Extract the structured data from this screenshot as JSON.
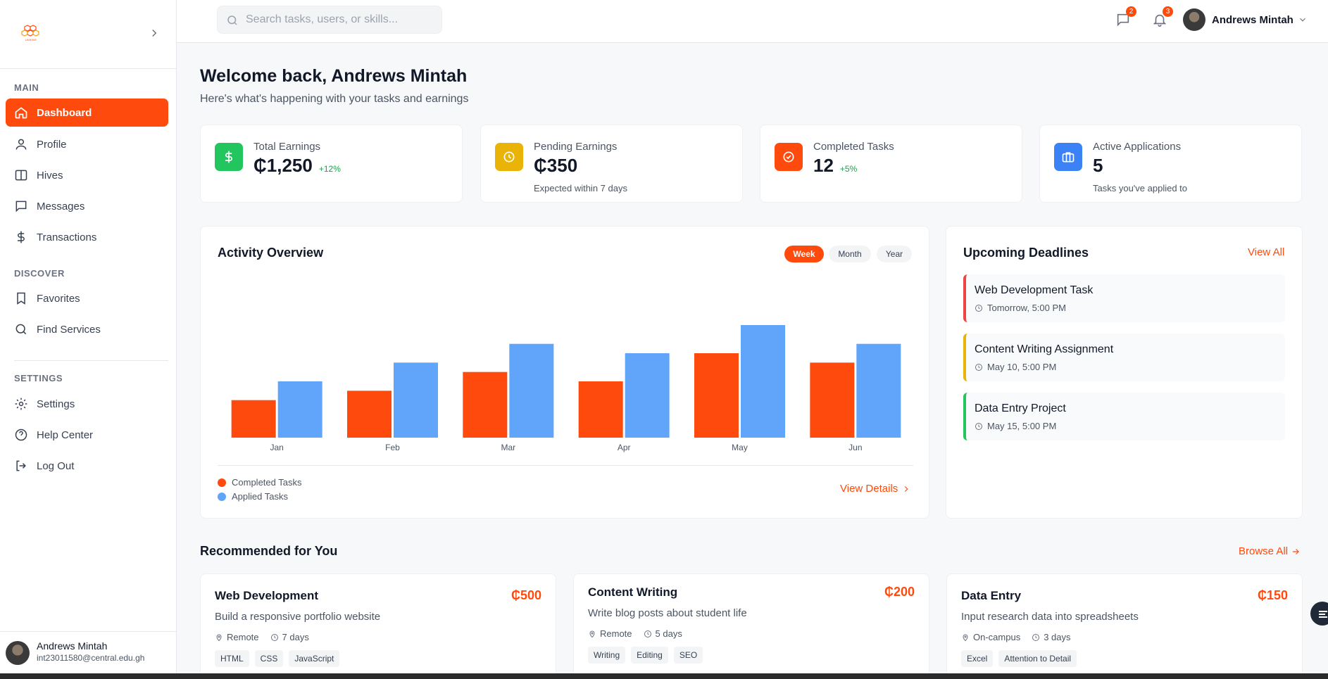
{
  "sidebar": {
    "logo_label": "UNIHIVE",
    "sections": {
      "main": "MAIN",
      "discover": "DISCOVER",
      "settings": "SETTINGS"
    },
    "items": {
      "dashboard": "Dashboard",
      "profile": "Profile",
      "hives": "Hives",
      "messages": "Messages",
      "transactions": "Transactions",
      "favorites": "Favorites",
      "find_services": "Find Services",
      "settings": "Settings",
      "help_center": "Help Center",
      "log_out": "Log Out"
    },
    "user": {
      "name": "Andrews Mintah",
      "email": "int23011580@central.edu.gh"
    }
  },
  "topbar": {
    "search_placeholder": "Search tasks, users, or skills...",
    "messages_badge": "2",
    "notifications_badge": "3",
    "user_name": "Andrews Mintah"
  },
  "welcome": {
    "title": "Welcome back, Andrews Mintah",
    "subtitle": "Here's what's happening with your tasks and earnings"
  },
  "stats": [
    {
      "label": "Total Earnings",
      "value": "₵1,250",
      "delta": "+12%",
      "note": ""
    },
    {
      "label": "Pending Earnings",
      "value": "₵350",
      "delta": "",
      "note": "Expected within 7 days"
    },
    {
      "label": "Completed Tasks",
      "value": "12",
      "delta": "+5%",
      "note": ""
    },
    {
      "label": "Active Applications",
      "value": "5",
      "delta": "",
      "note": "Tasks you've applied to"
    }
  ],
  "activity": {
    "title": "Activity Overview",
    "ranges": [
      "Week",
      "Month",
      "Year"
    ],
    "active_range": "Week",
    "view_details": "View Details",
    "colors": {
      "completed": "#ff4a0d",
      "applied": "#60a5fa"
    }
  },
  "chart_data": {
    "type": "bar",
    "categories": [
      "Jan",
      "Feb",
      "Mar",
      "Apr",
      "May",
      "Jun"
    ],
    "series": [
      {
        "name": "Completed Tasks",
        "values": [
          4,
          5,
          7,
          6,
          9,
          8
        ]
      },
      {
        "name": "Applied Tasks",
        "values": [
          6,
          8,
          10,
          9,
          12,
          10
        ]
      }
    ],
    "ylim": [
      0,
      12
    ]
  },
  "deadlines": {
    "title": "Upcoming Deadlines",
    "view_all": "View All",
    "items": [
      {
        "title": "Web Development Task",
        "due": "Tomorrow, 5:00 PM",
        "color": "#ef4444"
      },
      {
        "title": "Content Writing Assignment",
        "due": "May 10, 5:00 PM",
        "color": "#eab308"
      },
      {
        "title": "Data Entry Project",
        "due": "May 15, 5:00 PM",
        "color": "#22c55e"
      }
    ]
  },
  "recommended": {
    "title": "Recommended for You",
    "browse_all": "Browse All",
    "items": [
      {
        "title": "Web Development",
        "price": "₵500",
        "desc": "Build a responsive portfolio website",
        "location": "Remote",
        "duration": "7 days",
        "tags": [
          "HTML",
          "CSS",
          "JavaScript"
        ]
      },
      {
        "title": "Content Writing",
        "price": "₵200",
        "desc": "Write blog posts about student life",
        "location": "Remote",
        "duration": "5 days",
        "tags": [
          "Writing",
          "Editing",
          "SEO"
        ]
      },
      {
        "title": "Data Entry",
        "price": "₵150",
        "desc": "Input research data into spreadsheets",
        "location": "On-campus",
        "duration": "3 days",
        "tags": [
          "Excel",
          "Attention to Detail"
        ]
      }
    ]
  }
}
